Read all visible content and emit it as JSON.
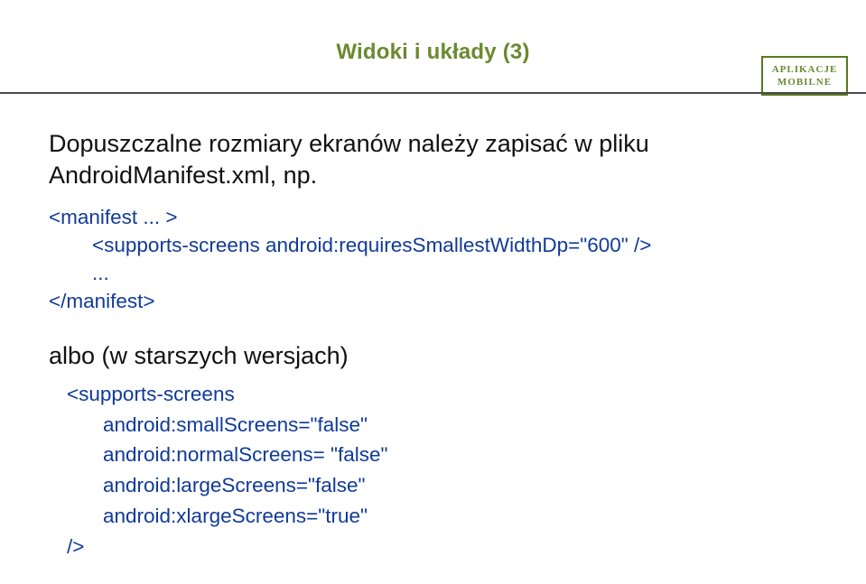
{
  "header": {
    "title": "Widoki i układy (3)",
    "corner_line1": "APLIKACJE",
    "corner_line2": "MOBILNE"
  },
  "section1": {
    "intro_line1": "Dopuszczalne rozmiary ekranów należy zapisać w pliku",
    "intro_line2": "AndroidManifest.xml, np.",
    "code_line1": "<manifest ... >",
    "code_line2": "<supports-screens android:requiresSmallestWidthDp=\"600\" />",
    "code_line3": "...",
    "code_line4": "</manifest>"
  },
  "section2": {
    "intro": "albo (w starszych wersjach)",
    "code_line1": "<supports-screens",
    "code_line2": "android:smallScreens=\"false\"",
    "code_line3": "android:normalScreens= \"false\"",
    "code_line4": "android:largeScreens=\"false\"",
    "code_line5": "android:xlargeScreens=\"true\"",
    "code_line6": "/>"
  }
}
